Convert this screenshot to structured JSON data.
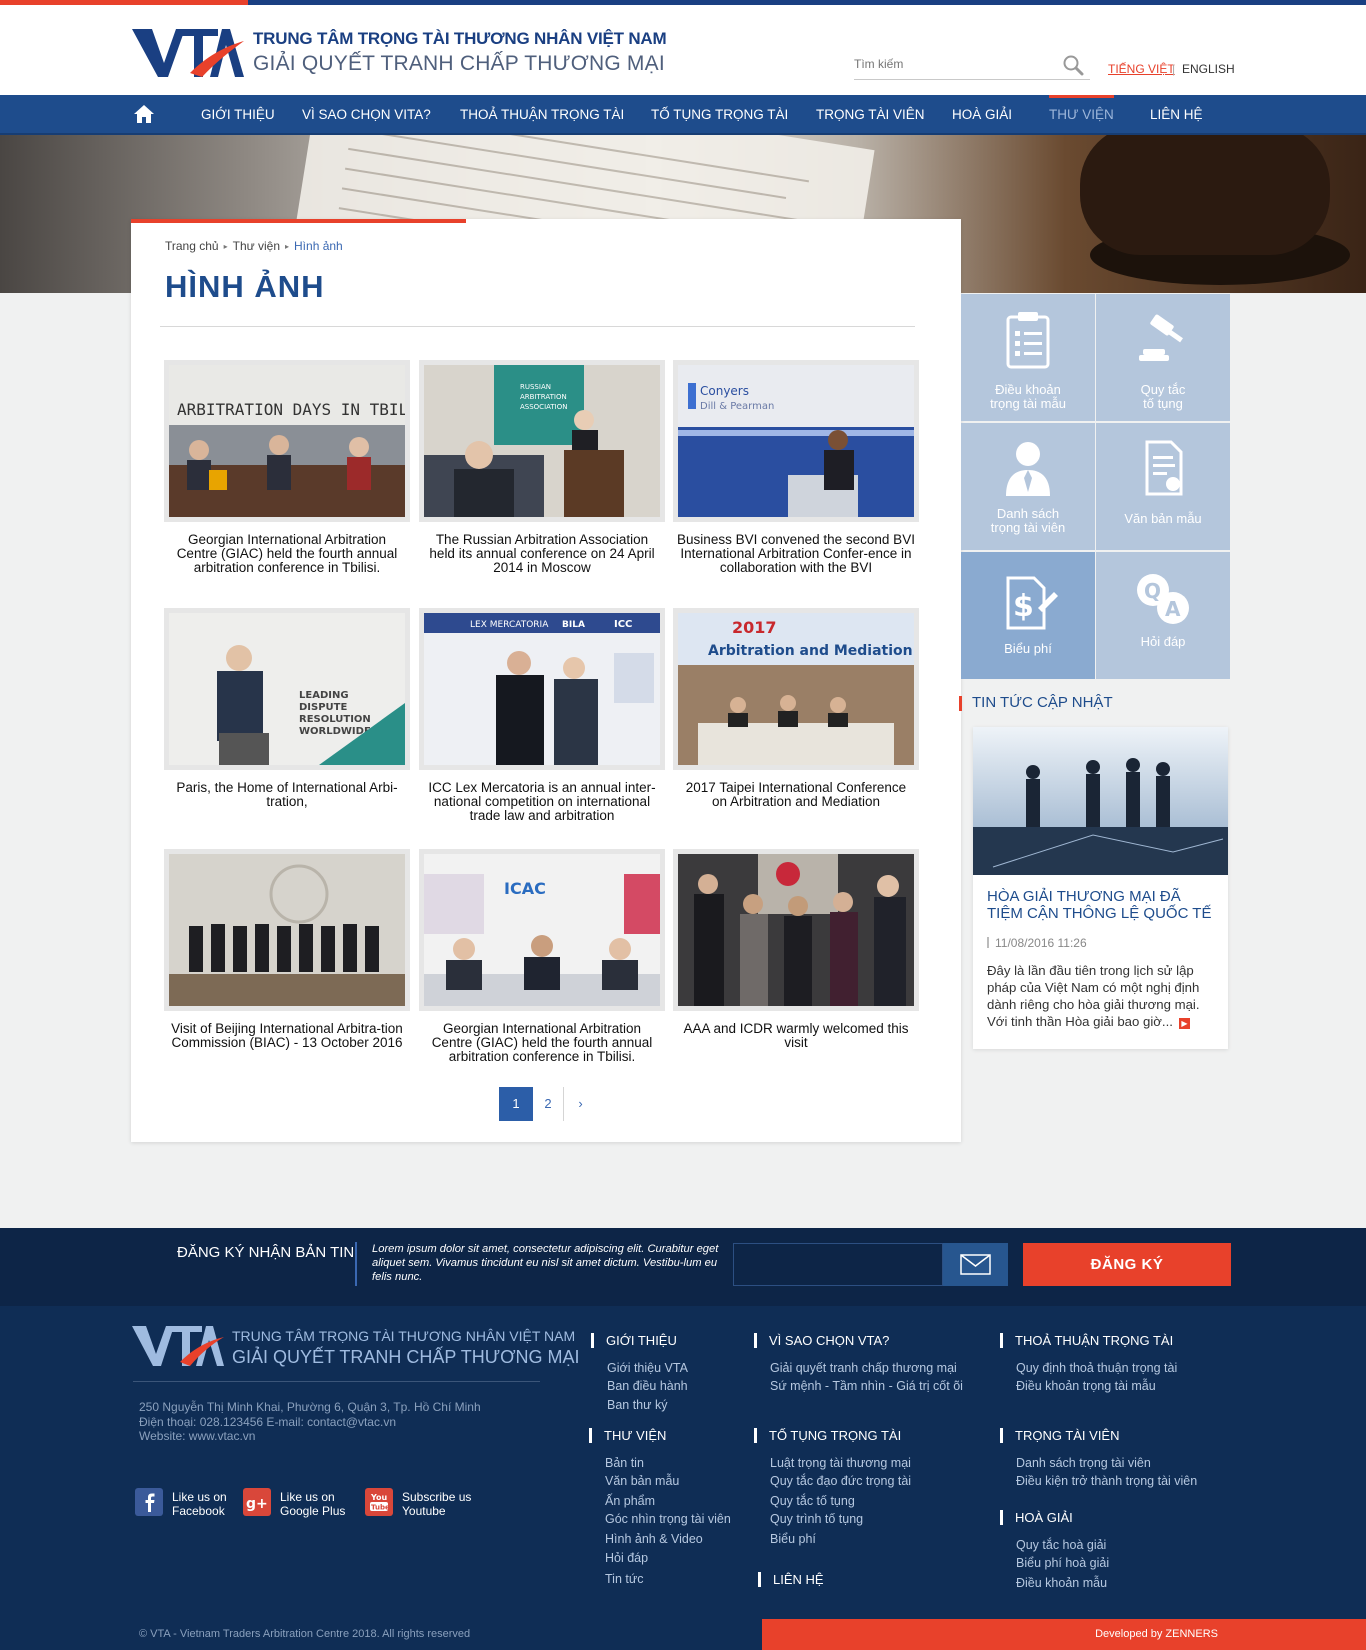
{
  "brand": {
    "logo_text": "VTA",
    "line1": "TRUNG TÂM TRỌNG TÀI THƯƠNG NHÂN VIỆT NAM",
    "line2": "GIẢI QUYẾT TRANH CHẤP THƯƠNG MẠI"
  },
  "search": {
    "placeholder": "Tìm kiếm",
    "icon": "search-icon"
  },
  "languages": {
    "vi": "TIẾNG VIỆT",
    "separator": "|",
    "en": "ENGLISH"
  },
  "nav": {
    "home_icon": "home-icon",
    "items": [
      {
        "label": "GIỚI THIỆU"
      },
      {
        "label": "VÌ SAO CHỌN VITA?"
      },
      {
        "label": "THOẢ THUẬN TRỌNG TÀI"
      },
      {
        "label": "TỐ TỤNG TRỌNG TÀI"
      },
      {
        "label": "TRỌNG TÀI VIÊN"
      },
      {
        "label": "HOÀ GIẢI"
      },
      {
        "label": "THƯ VIỆN"
      },
      {
        "label": "LIÊN HỆ"
      }
    ],
    "active": "THƯ VIỆN"
  },
  "breadcrumb": [
    "Trang chủ",
    "Thư viện",
    "Hình ảnh"
  ],
  "page_title": "HÌNH ẢNH",
  "gallery": [
    {
      "caption": "Georgian International Arbitration Centre (GIAC) held the fourth annual arbitration conference in Tbilisi.",
      "image_text": "ARBITRATION DAYS IN TBILI"
    },
    {
      "caption": "The Russian Arbitration Association held its annual conference on 24 April 2014 in Moscow",
      "image_text": "RUSSIAN ARBITRATION ASSOCIATION"
    },
    {
      "caption": "Business BVI convened the second BVI International Arbitration Confer-ence in collaboration with the BVI",
      "image_text": "Conyers Dill & Pearman"
    },
    {
      "caption": "Paris, the Home of International Arbi-tration,",
      "image_text": "LEADING DISPUTE RESOLUTION WORLDWIDE"
    },
    {
      "caption": "ICC Lex Mercatoria is an annual inter-national competition on international trade law and arbitration",
      "image_text": "LEX MERCATORIA"
    },
    {
      "caption": "2017 Taipei International Conference on Arbitration and Mediation",
      "image_text": "2017 Arbitration and Mediation"
    },
    {
      "caption": "Visit of Beijing International Arbitra-tion Commission (BIAC) - 13 October 2016",
      "image_text": ""
    },
    {
      "caption": "Georgian International Arbitration Centre (GIAC) held the fourth annual arbitration conference in Tbilisi.",
      "image_text": "ICAC"
    },
    {
      "caption": "AAA and ICDR warmly welcomed this visit",
      "image_text": ""
    }
  ],
  "pagination": {
    "pages": [
      "1",
      "2"
    ],
    "current": "1",
    "next": "›"
  },
  "sidebar_tiles": [
    {
      "label1": "Điều khoản",
      "label2": "trọng tài mẫu",
      "icon": "clipboard-icon"
    },
    {
      "label1": "Quy tắc",
      "label2": "tố tụng",
      "icon": "gavel-icon"
    },
    {
      "label1": "Danh sách",
      "label2": "trọng tài viên",
      "icon": "person-icon"
    },
    {
      "label1": "Văn bản mẫu",
      "label2": "",
      "icon": "document-icon"
    },
    {
      "label1": "Biểu phí",
      "label2": "",
      "icon": "dollar-document-icon"
    },
    {
      "label1": "Hỏi đáp",
      "label2": "",
      "icon": "qa-icon"
    }
  ],
  "news": {
    "heading": "TIN TỨC CẬP NHẬT",
    "title": "HÒA GIẢI THƯƠNG MẠI ĐÃ TIỆM CẬN THÔNG LỆ QUỐC TẾ",
    "date": "11/08/2016 11:26",
    "excerpt": "Đây là lần đầu tiên trong lịch sử lập pháp của Việt Nam có một nghị định dành riêng cho hòa giải thương mại. Với tinh thần Hòa giải bao giờ...",
    "more_icon": "arrow-right-icon"
  },
  "newsletter": {
    "title": "ĐĂNG KÝ NHẬN BẢN TIN",
    "text": "Lorem ipsum dolor sit amet, consectetur adipiscing elit. Curabitur eget aliquet sem. Vivamus tincidunt eu nisl sit amet dictum. Vestibu-lum eu felis nunc.",
    "input_value": "",
    "button": "ĐĂNG KÝ",
    "mail_icon": "envelope-icon"
  },
  "footer": {
    "address": "250 Nguyễn Thị Minh Khai, Phường 6, Quận 3, Tp. Hồ Chí Minh",
    "phone": "Điện thoại: 028.123456 E-mail: contact@vtac.vn",
    "website": "Website: www.vtac.vn",
    "social": [
      {
        "line1": "Like us on",
        "line2": "Facebook",
        "icon": "facebook-icon"
      },
      {
        "line1": "Like us on",
        "line2": "Google Plus",
        "icon": "google-plus-icon"
      },
      {
        "line1": "Subscribe us",
        "line2": "Youtube",
        "icon": "youtube-icon"
      }
    ],
    "columns": [
      {
        "heading": "GIỚI THIỆU",
        "links": [
          "Giới thiệu VTA",
          "Ban điều hành",
          "Ban thư ký"
        ]
      },
      {
        "heading": "VÌ SAO CHỌN VTA?",
        "links": [
          "Giải quyết tranh chấp thương mại",
          "Sứ mệnh - Tầm  nhìn - Giá trị cốt õi"
        ]
      },
      {
        "heading": "THOẢ THUẬN TRỌNG TÀI",
        "links": [
          "Quy định thoả thuận trọng tài",
          "Điều khoản trọng tài mẫu"
        ]
      },
      {
        "heading": "THƯ VIỆN",
        "links": [
          "Bản tin",
          "Văn bản mẫu",
          "Ấn phẩm",
          "Góc nhìn trọng tài viên",
          "Hình ảnh & Video",
          "Hỏi đáp",
          "Tin tức"
        ]
      },
      {
        "heading": "TỐ TỤNG TRỌNG TÀI",
        "links": [
          "Luật trọng tài thương mại",
          "Quy tắc đạo đức trọng tài",
          "Quy tắc tố tụng",
          "Quy trình tố tụng",
          "Biểu phí"
        ]
      },
      {
        "heading": "TRỌNG TÀI VIÊN",
        "links": [
          "Danh sách trọng tài viên",
          "Điều kiện trở thành trọng tài viên"
        ]
      },
      {
        "heading": "HOÀ GIẢI",
        "links": [
          "Quy tắc hoà giải",
          "Biểu phí hoà giải",
          "Điều khoản mẫu"
        ]
      },
      {
        "heading": "LIÊN HỆ",
        "links": []
      }
    ],
    "copyright": "© VTA - Vietnam Traders Arbitration Centre  2018. All rights reserved",
    "developed_by": "Developed by ZENNERS"
  },
  "colors": {
    "brand_blue": "#1e4c8c",
    "accent_red": "#e8412b",
    "footer_navy": "#0f2d55",
    "tile_blue": "#b4c6dc"
  }
}
